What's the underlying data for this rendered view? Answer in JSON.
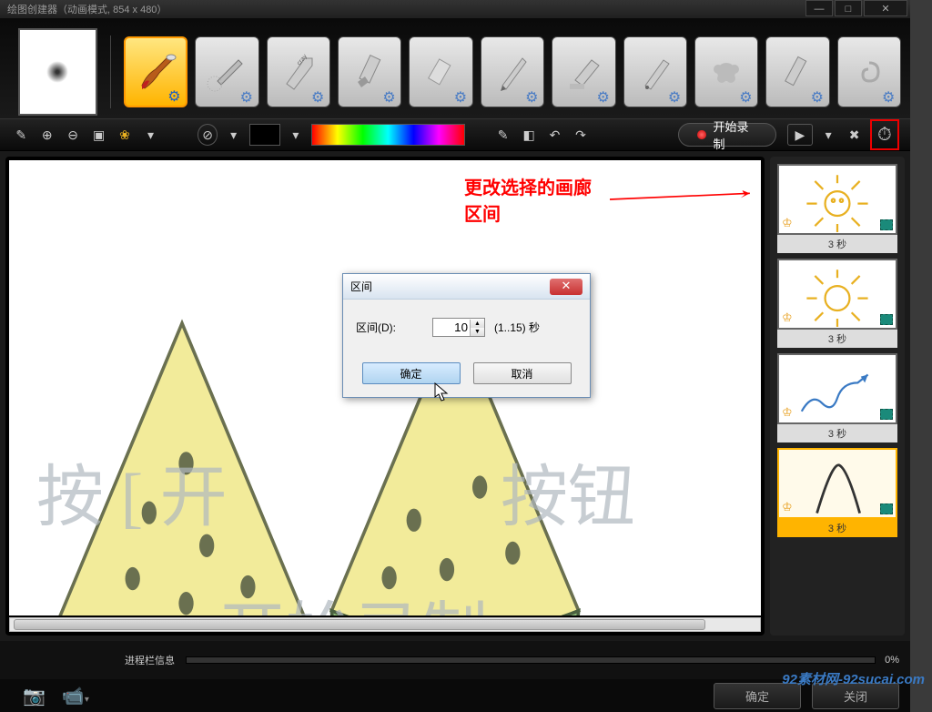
{
  "title": "绘图创建器（动画模式, 854 x 480）",
  "record_button": "开始录制",
  "annotation": "更改选择的画廊区间",
  "ghost": {
    "t1": "按 [ 开",
    "t2": "按钮",
    "t3": "开始录制"
  },
  "dialog": {
    "title": "区间",
    "label": "区间(D):",
    "value": "10",
    "range": "(1..15) 秒",
    "ok": "确定",
    "cancel": "取消"
  },
  "frames": [
    {
      "label": "3 秒"
    },
    {
      "label": "3 秒"
    },
    {
      "label": "3 秒"
    },
    {
      "label": "3 秒"
    }
  ],
  "progress": {
    "label": "进程栏信息",
    "pct": "0%"
  },
  "footer": {
    "ok": "确定",
    "close": "关闭"
  },
  "watermark": "92素材网-92sucai.com"
}
